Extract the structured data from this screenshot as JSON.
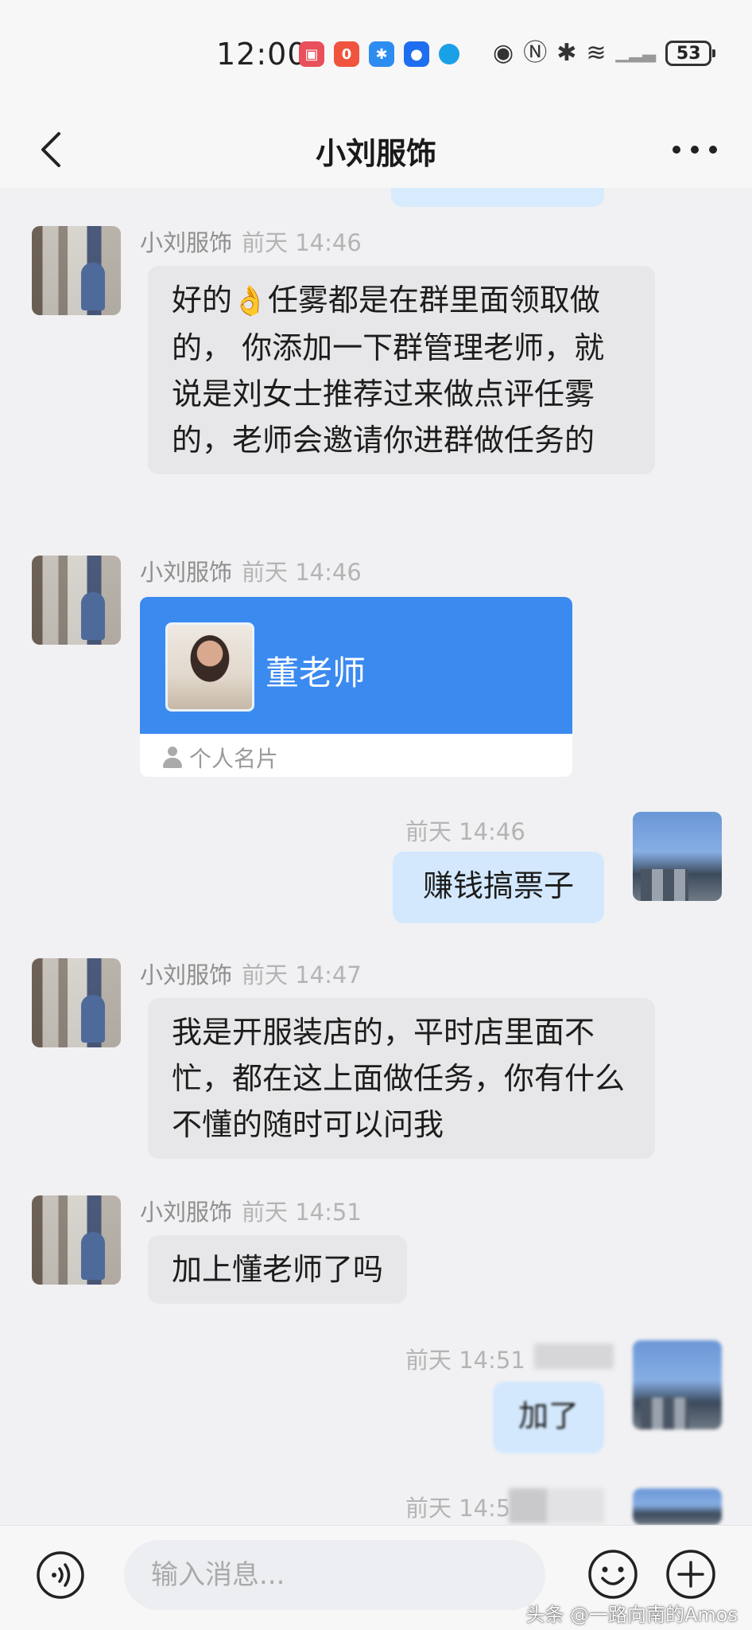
{
  "status_bar": {
    "time": "12:00",
    "notif_glyphs": [
      "▣",
      "0",
      "✱",
      "●",
      "◆"
    ],
    "sys_glyphs": [
      "◉",
      "Ⓝ",
      "✱",
      "≋",
      "▁▂▃"
    ],
    "battery": "53"
  },
  "header": {
    "title": "小刘服饰"
  },
  "messages": [
    {
      "sender": "小刘服饰",
      "time": "前天 14:46",
      "text_pre": "好的",
      "emoji": "👌",
      "text_post": "任雾都是在群里面领取做的，  你添加一下群管理老师，就说是刘女士推荐过来做点评任雾的，老师会邀请你进群做任务的"
    },
    {
      "sender": "小刘服饰",
      "time": "前天 14:46",
      "card_name": "董老师",
      "card_label": "个人名片"
    },
    {
      "time": "前天 14:46",
      "text": "赚钱搞票子"
    },
    {
      "sender": "小刘服饰",
      "time": "前天 14:47",
      "text": "我是开服装店的，平时店里面不忙，都在这上面做任务，你有什么不懂的随时可以问我"
    },
    {
      "sender": "小刘服饰",
      "time": "前天 14:51",
      "text": "加上懂老师了吗"
    },
    {
      "time": "前天 14:51",
      "text": "加了"
    },
    {
      "time": "前天 14:5"
    }
  ],
  "input_bar": {
    "placeholder": "输入消息..."
  },
  "watermark": "头条 @一路向南的Amos"
}
